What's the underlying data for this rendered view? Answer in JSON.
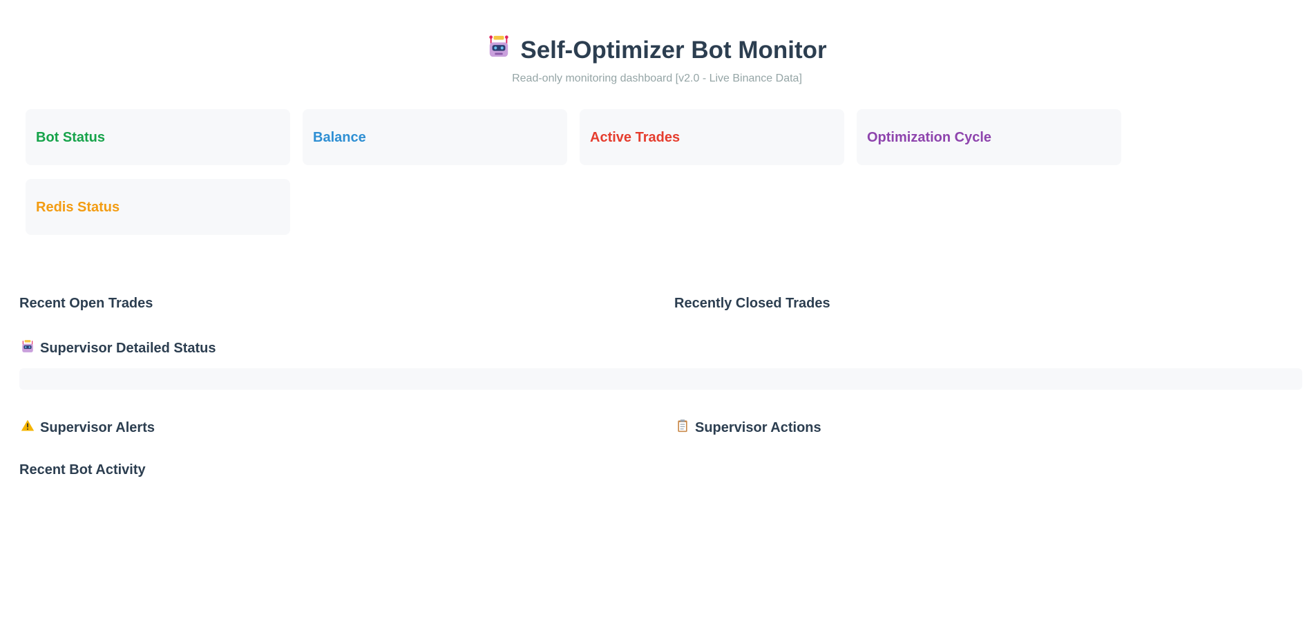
{
  "header": {
    "title": "Self-Optimizer Bot Monitor",
    "title_icon": "robot-icon",
    "subtitle": "Read-only monitoring dashboard [v2.0 - Live Binance Data]"
  },
  "cards": [
    {
      "label": "Bot Status",
      "color": "#16a34a"
    },
    {
      "label": "Balance",
      "color": "#2e8fd3"
    },
    {
      "label": "Active Trades",
      "color": "#e53d2e"
    },
    {
      "label": "Optimization Cycle",
      "color": "#8e44ad"
    },
    {
      "label": "Redis Status",
      "color": "#f39c12"
    }
  ],
  "sections": {
    "recent_open_trades": "Recent Open Trades",
    "recently_closed_trades": "Recently Closed Trades",
    "supervisor_detailed_status": "Supervisor Detailed Status",
    "supervisor_detailed_status_icon": "robot-icon",
    "supervisor_alerts": "Supervisor Alerts",
    "supervisor_alerts_icon": "warning-icon",
    "supervisor_actions": "Supervisor Actions",
    "supervisor_actions_icon": "clipboard-icon",
    "recent_bot_activity": "Recent Bot Activity"
  }
}
